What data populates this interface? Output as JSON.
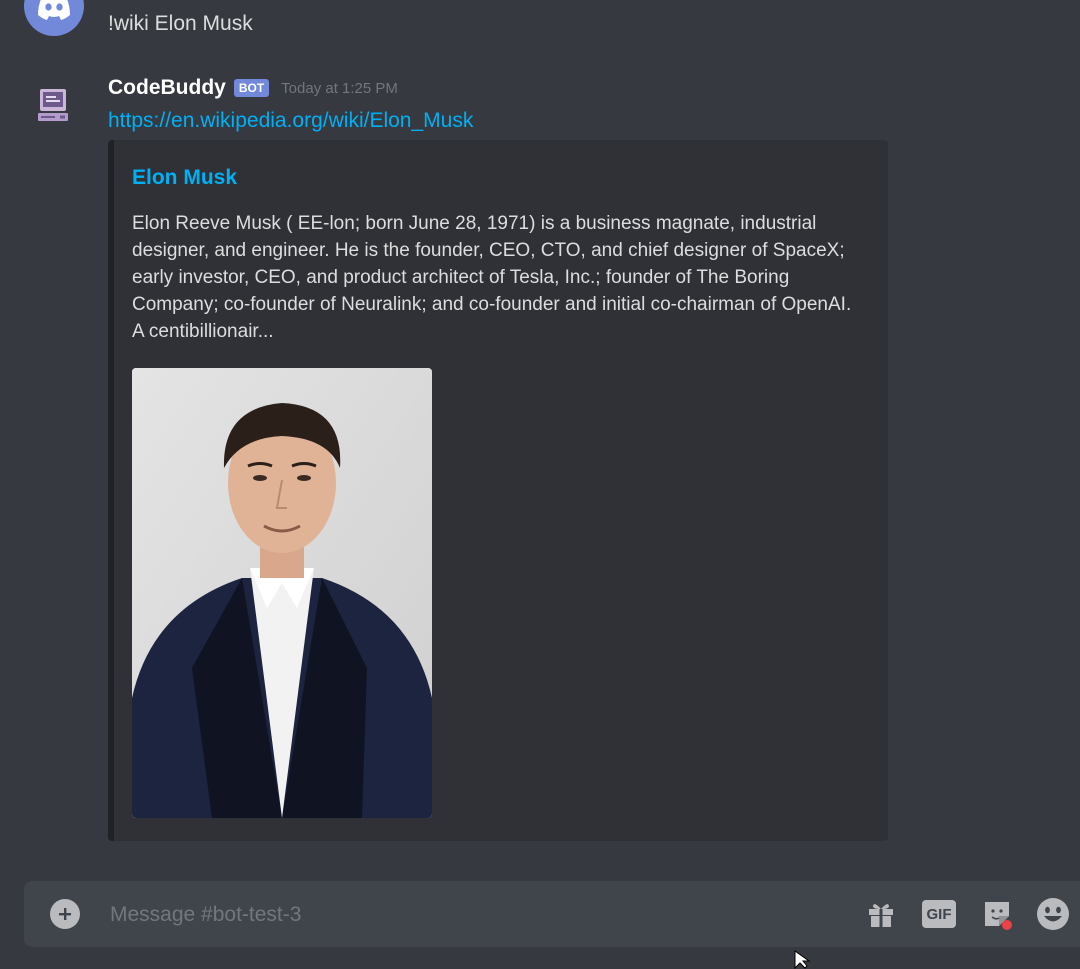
{
  "previous_message": {
    "text": "!wiki Elon Musk"
  },
  "bot_message": {
    "username": "CodeBuddy",
    "badge": "BOT",
    "timestamp": "Today at 1:25 PM",
    "link": "https://en.wikipedia.org/wiki/Elon_Musk",
    "embed": {
      "title": "Elon Musk",
      "description": "Elon Reeve Musk ( EE-lon; born June 28, 1971) is a business magnate, industrial designer, and engineer. He is the founder, CEO, CTO, and chief designer of SpaceX; early investor, CEO, and product architect of Tesla, Inc.; founder of The Boring Company; co-founder of Neuralink; and co-founder and initial co-chairman of OpenAI. A centibillionair..."
    }
  },
  "composer": {
    "placeholder": "Message #bot-test-3",
    "gif_label": "GIF"
  },
  "icons": {
    "discord_avatar": "discord-logo-icon",
    "bot_avatar": "retro-computer-icon",
    "add": "plus-circle-icon",
    "gift": "gift-icon",
    "gif": "gif-icon",
    "sticker": "sticker-icon",
    "emoji": "smiley-icon"
  },
  "colors": {
    "background": "#36393f",
    "embed_bg": "#2f3136",
    "link": "#00b0f4",
    "bot_badge": "#7289da",
    "composer_bg": "#40444b"
  }
}
